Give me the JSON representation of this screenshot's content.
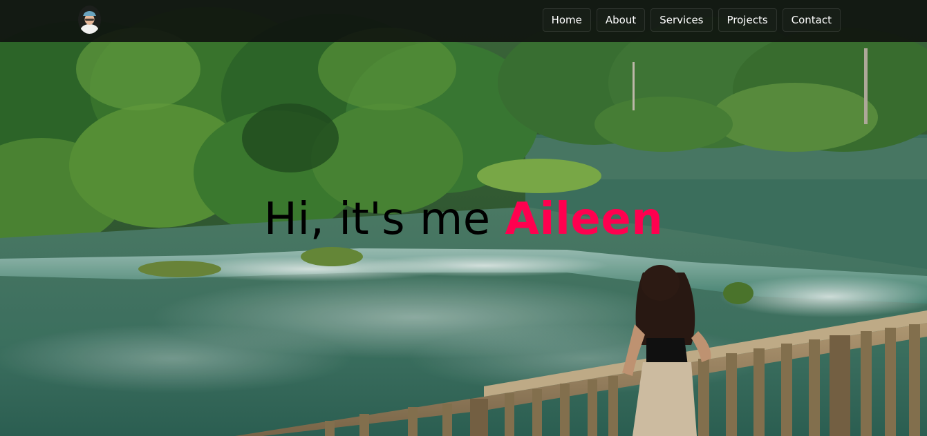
{
  "header": {
    "logo_alt": "Profile avatar",
    "nav": [
      {
        "label": "Home"
      },
      {
        "label": "About"
      },
      {
        "label": "Services"
      },
      {
        "label": "Projects"
      },
      {
        "label": "Contact"
      }
    ]
  },
  "hero": {
    "greeting": "Hi, it's me",
    "name": "Aileen"
  },
  "colors": {
    "accent": "#ff004f",
    "header_bg": "#0e100e",
    "text_dark": "#000000",
    "nav_text": "#ffffff"
  }
}
